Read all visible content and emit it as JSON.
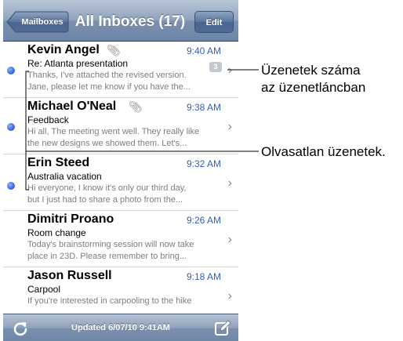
{
  "navbar": {
    "back_label": "Mailboxes",
    "title": "All Inboxes (17)",
    "edit_label": "Edit"
  },
  "messages": [
    {
      "sender": "Kevin Angel",
      "has_attachment": true,
      "time": "9:40 AM",
      "subject": "Re: Atlanta presentation",
      "preview": [
        "Thanks, I've attached the revised version.",
        "Jane, please let me know if you have the..."
      ],
      "unread": true,
      "thread_count": "3"
    },
    {
      "sender": "Michael O'Neal",
      "has_attachment": true,
      "time": "9:38 AM",
      "subject": "Feedback",
      "preview": [
        "Hi all, The meeting went well. They really like",
        "the new designs we showed them. Let's..."
      ],
      "unread": true,
      "thread_count": ""
    },
    {
      "sender": "Erin Steed",
      "has_attachment": false,
      "time": "9:32 AM",
      "subject": "Australia vacation",
      "preview": [
        "Hi everyone, I know it's only our third day,",
        "but I just had to share a photo from the..."
      ],
      "unread": true,
      "thread_count": ""
    },
    {
      "sender": "Dimitri Proano",
      "has_attachment": false,
      "time": "9:26 AM",
      "subject": "Room change",
      "preview": [
        "Today's brainstorming session will now take",
        "place in 23D. Please remember to bring..."
      ],
      "unread": false,
      "thread_count": ""
    },
    {
      "sender": "Jason Russell",
      "has_attachment": false,
      "time": "9:18 AM",
      "subject": "Carpool",
      "preview": [
        "If you're interested in carpooling to the hike",
        ""
      ],
      "unread": false,
      "thread_count": ""
    }
  ],
  "toolbar": {
    "status": "Updated 6/07/10 9:41AM",
    "refresh_icon": "refresh-icon",
    "compose_icon": "compose-icon"
  },
  "callouts": {
    "thread_count_line1": "Üzenetek száma",
    "thread_count_line2": "az üzenetláncban",
    "unread": "Olvasatlan üzenetek."
  },
  "colors": {
    "unread_dot": "#3f6fe0",
    "time_text": "#2f5fd0",
    "navbar": "#7a91b1"
  }
}
